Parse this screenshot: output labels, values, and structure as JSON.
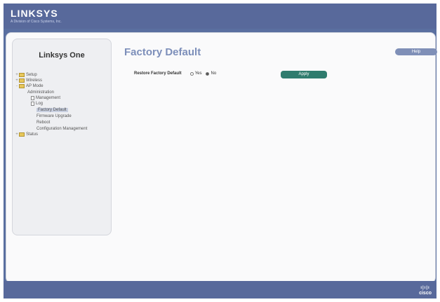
{
  "brand": {
    "logo_text": "LINKSYS",
    "tagline": "A Division of Cisco Systems, Inc.",
    "footer_logo": "cisco"
  },
  "sidebar": {
    "title": "Linksys One",
    "items": [
      {
        "label": "Setup",
        "icon": "folder-icon"
      },
      {
        "label": "Wireless",
        "icon": "folder-icon"
      },
      {
        "label": "AP Mode",
        "icon": "folder-icon"
      },
      {
        "label": "Administration",
        "icon": "none"
      },
      {
        "label": "Management",
        "icon": "page-icon"
      },
      {
        "label": "Log",
        "icon": "page-icon"
      },
      {
        "label": "Factory Default",
        "icon": "none",
        "selected": true
      },
      {
        "label": "Firmware Upgrade",
        "icon": "none"
      },
      {
        "label": "Reboot",
        "icon": "none"
      },
      {
        "label": "Configuration Management",
        "icon": "none"
      },
      {
        "label": "Status",
        "icon": "folder-icon"
      }
    ]
  },
  "content": {
    "title": "Factory Default",
    "help_label": "Help",
    "restore_label": "Restore Factory Default",
    "option_yes": "Yes",
    "option_no": "No",
    "selected_option": "No",
    "apply_label": "Apply"
  },
  "colors": {
    "bar": "#58699b",
    "title": "#7d8fba",
    "apply": "#2f7c6e"
  }
}
